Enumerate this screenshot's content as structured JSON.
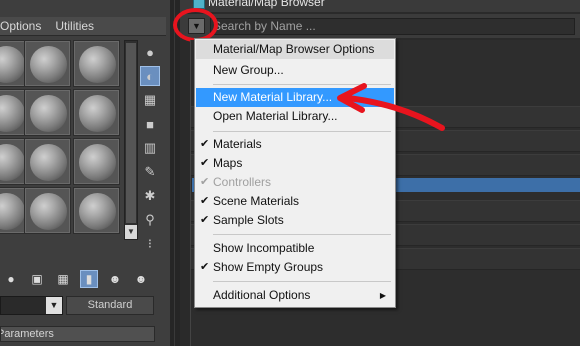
{
  "material_editor": {
    "menu_items": [
      "Options",
      "Utilities"
    ],
    "sample_slots_rows": 4,
    "type_button": "Standard",
    "rollout_label": "Parameters"
  },
  "browser": {
    "title": "Material/Map Browser",
    "search_placeholder": "Search by Name ...",
    "options_button_icon": "triangle-down-icon"
  },
  "context_menu": {
    "header": "Material/Map Browser Options",
    "items": [
      {
        "label": "New Group...",
        "checked": false,
        "enabled": true,
        "hover": false
      },
      {
        "label": "New Material Library...",
        "checked": false,
        "enabled": true,
        "hover": true
      },
      {
        "label": "Open Material Library...",
        "checked": false,
        "enabled": true,
        "hover": false
      },
      {
        "label": "Materials",
        "checked": true,
        "enabled": true,
        "hover": false
      },
      {
        "label": "Maps",
        "checked": true,
        "enabled": true,
        "hover": false
      },
      {
        "label": "Controllers",
        "checked": true,
        "enabled": false,
        "hover": false
      },
      {
        "label": "Scene Materials",
        "checked": true,
        "enabled": true,
        "hover": false
      },
      {
        "label": "Sample Slots",
        "checked": true,
        "enabled": true,
        "hover": false
      },
      {
        "label": "Show Incompatible",
        "checked": false,
        "enabled": true,
        "hover": false
      },
      {
        "label": "Show Empty Groups",
        "checked": true,
        "enabled": true,
        "hover": false
      },
      {
        "label": "Additional Options",
        "checked": false,
        "enabled": true,
        "hover": false,
        "submenu": true
      }
    ]
  },
  "colors": {
    "annotation_red": "#e8141e",
    "menu_highlight": "#3399ff",
    "selection_blue": "#3d6fa8"
  }
}
